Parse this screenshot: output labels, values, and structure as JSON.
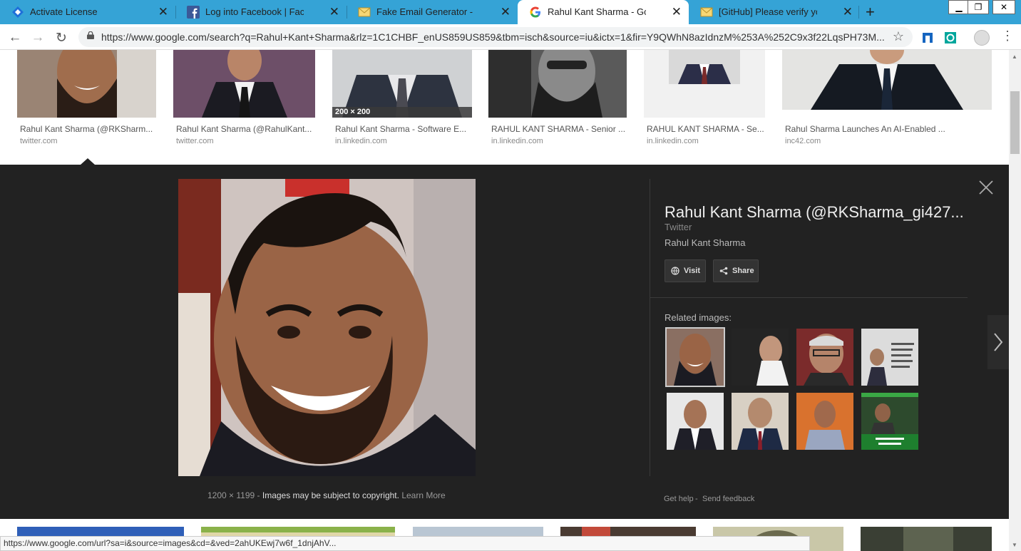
{
  "browser": {
    "tabs": [
      {
        "title": "Activate License",
        "favicon": "diamond-icon"
      },
      {
        "title": "Log into Facebook | Facebook",
        "favicon": "facebook-icon"
      },
      {
        "title": "Fake Email Generator - fake ema",
        "favicon": "envelope-icon"
      },
      {
        "title": "Rahul Kant Sharma - Google Sea",
        "favicon": "google-icon",
        "active": true
      },
      {
        "title": "[GitHub] Please verify your devic",
        "favicon": "envelope-icon"
      }
    ],
    "new_tab_label": "+",
    "url": "https://www.google.com/search?q=Rahul+Kant+Sharma&rlz=1C1CHBF_enUS859US859&tbm=isch&source=iu&ictx=1&fir=Y9QWhN8azIdnzM%253A%252C9x3f22LqsPH73M..."
  },
  "results": [
    {
      "title": "Rahul Kant Sharma (@RKSharm...",
      "source": "twitter.com"
    },
    {
      "title": "Rahul Kant Sharma (@RahulKant...",
      "source": "twitter.com"
    },
    {
      "title": "Rahul Kant Sharma - Software E...",
      "source": "in.linkedin.com",
      "dims": "200 × 200"
    },
    {
      "title": "RAHUL KANT SHARMA - Senior ...",
      "source": "in.linkedin.com"
    },
    {
      "title": "RAHUL KANT SHARMA - Se...",
      "source": "in.linkedin.com"
    },
    {
      "title": "Rahul Sharma Launches An AI-Enabled ...",
      "source": "inc42.com"
    }
  ],
  "viewer": {
    "title": "Rahul Kant Sharma (@RKSharma_gi427...",
    "site": "Twitter",
    "description": "Rahul Kant Sharma",
    "visit_label": "Visit",
    "share_label": "Share",
    "related_label": "Related images:",
    "image_dims": "1200 × 1199",
    "copyright_text": "Images may be subject to copyright.",
    "learn_more": "Learn More",
    "get_help": "Get help",
    "send_feedback": "Send feedback"
  },
  "status_url": "https://www.google.com/url?sa=i&source=images&cd=&ved=2ahUKEwj7w6f_1dnjAhV...",
  "colors": {
    "tab_strip": "#35a3d6",
    "viewer_bg": "#222222",
    "accent": "#1a73e8"
  }
}
